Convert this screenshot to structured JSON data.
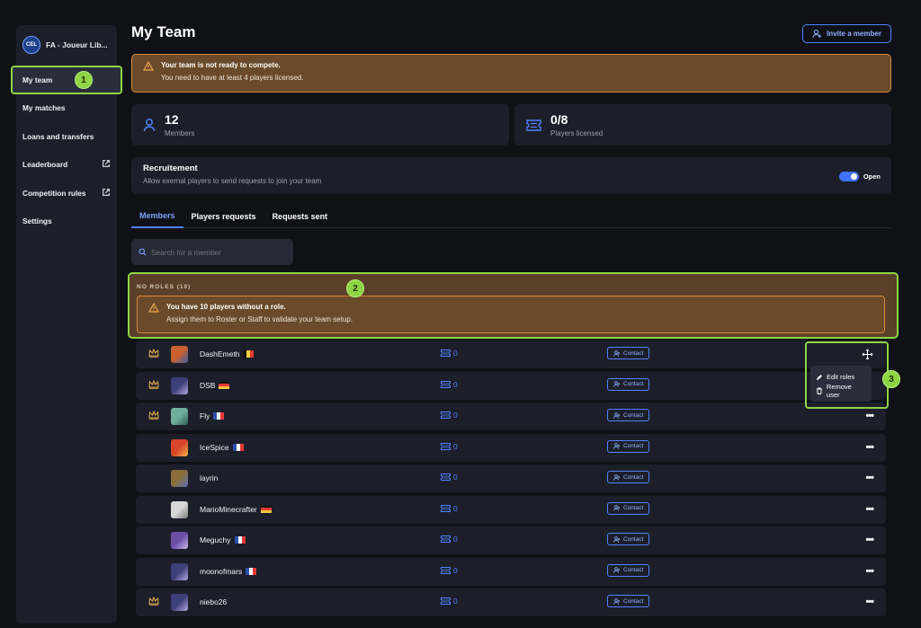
{
  "sidebar": {
    "team_name": "FA - Joueur Lib...",
    "team_logo_text": "CEL",
    "items": [
      {
        "label": "My team",
        "active": true,
        "external": false
      },
      {
        "label": "My matches",
        "active": false,
        "external": false
      },
      {
        "label": "Loans and transfers",
        "active": false,
        "external": false
      },
      {
        "label": "Leaderboard",
        "active": false,
        "external": true
      },
      {
        "label": "Competition rules",
        "active": false,
        "external": true
      },
      {
        "label": "Settings",
        "active": false,
        "external": false
      }
    ]
  },
  "header": {
    "title": "My Team",
    "invite_label": "Invite a member"
  },
  "warning": {
    "title": "Your team is not ready to compete.",
    "subtitle": "You need to have at least 4 players licensed."
  },
  "stats": {
    "members": {
      "value": "12",
      "label": "Members"
    },
    "licensed": {
      "value": "0/8",
      "label": "Players licensed"
    }
  },
  "recruitment": {
    "title": "Recruitement",
    "subtitle": "Allow exernal players to send requests to join your team",
    "toggle_label": "Open",
    "toggle_on": true
  },
  "tabs": [
    {
      "label": "Members",
      "active": true
    },
    {
      "label": "Players requests",
      "active": false
    },
    {
      "label": "Requests sent",
      "active": false
    }
  ],
  "search": {
    "placeholder": "Search for a member"
  },
  "roles": {
    "header": "NO ROLES (10)",
    "title": "You have 10 players without a role.",
    "subtitle": "Assign them to Roster or Staff to validate your team setup."
  },
  "members": [
    {
      "name": "DashEmeth",
      "flag": "be",
      "crown": true,
      "licenses": "0",
      "contact": "Contact",
      "avatar": [
        "#c9622e",
        "#3a5fa8"
      ]
    },
    {
      "name": "DSB",
      "flag": "de",
      "crown": true,
      "licenses": "0",
      "contact": "Contact",
      "avatar": [
        "#3c3f7a",
        "#b7a6e8"
      ]
    },
    {
      "name": "Fly",
      "flag": "fr",
      "crown": true,
      "licenses": "0",
      "contact": "Contact",
      "avatar": [
        "#6fae9c",
        "#2e5e56"
      ]
    },
    {
      "name": "IceSpice",
      "flag": "fr",
      "crown": false,
      "licenses": "0",
      "contact": "Contact",
      "avatar": [
        "#d8452a",
        "#f2b24a"
      ]
    },
    {
      "name": "layrin",
      "flag": "",
      "crown": false,
      "licenses": "0",
      "contact": "Contact",
      "avatar": [
        "#8a6f3c",
        "#5b6fbf"
      ]
    },
    {
      "name": "MarioMinecrafter",
      "flag": "de",
      "crown": false,
      "licenses": "0",
      "contact": "Contact",
      "avatar": [
        "#d8d8d8",
        "#7a7a7a"
      ]
    },
    {
      "name": "Meguchy",
      "flag": "fr",
      "crown": false,
      "licenses": "0",
      "contact": "Contact",
      "avatar": [
        "#6d4fa6",
        "#cdb8f0"
      ]
    },
    {
      "name": "moonofmars",
      "flag": "fr",
      "crown": false,
      "licenses": "0",
      "contact": "Contact",
      "avatar": [
        "#3c3f7a",
        "#b7a6e8"
      ]
    },
    {
      "name": "niebo26",
      "flag": "",
      "crown": true,
      "licenses": "0",
      "contact": "Contact",
      "avatar": [
        "#3c3f7a",
        "#b7a6e8"
      ]
    }
  ],
  "row_menu": {
    "items": [
      {
        "label": "Edit roles",
        "icon": "pencil-icon"
      },
      {
        "label": "Remove user",
        "icon": "trash-icon"
      }
    ]
  },
  "callouts": [
    "1",
    "2",
    "3"
  ],
  "colors": {
    "accent": "#4f83ff",
    "warning_bg": "#6a4a2a",
    "warning_border": "#d88a3a",
    "highlight": "#8ed444",
    "crown": "#e0a84a"
  }
}
